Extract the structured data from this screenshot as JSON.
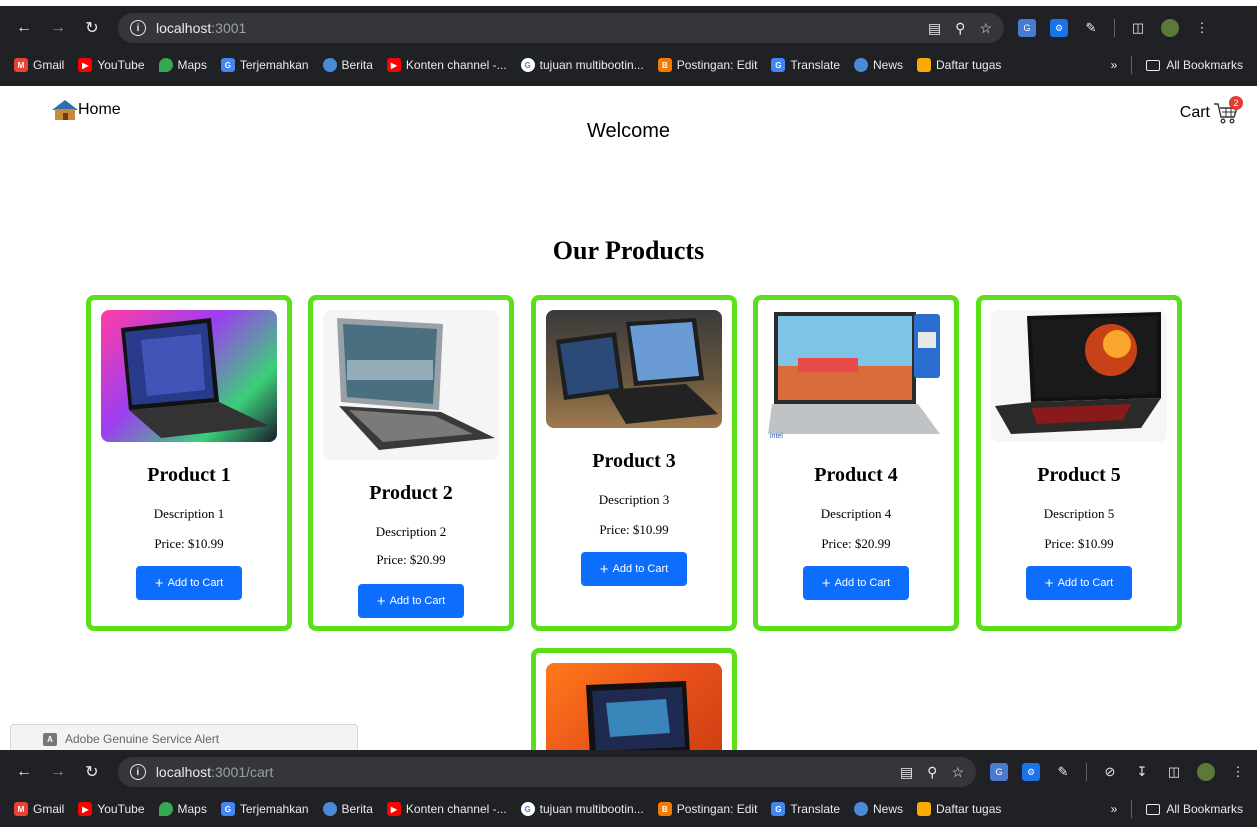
{
  "browser_top": {
    "url_host": "localhost",
    "url_rest": ":3001",
    "bookmarks": [
      {
        "label": "Gmail",
        "icon": "gmail-icon"
      },
      {
        "label": "YouTube",
        "icon": "youtube-icon"
      },
      {
        "label": "Maps",
        "icon": "maps-icon"
      },
      {
        "label": "Terjemahkan",
        "icon": "translate-icon"
      },
      {
        "label": "Berita",
        "icon": "news-icon"
      },
      {
        "label": "Konten channel -...",
        "icon": "youtube-icon"
      },
      {
        "label": "tujuan multibootin...",
        "icon": "google-icon"
      },
      {
        "label": "Postingan: Edit",
        "icon": "blogger-icon"
      },
      {
        "label": "Translate",
        "icon": "translate-icon"
      },
      {
        "label": "News",
        "icon": "news-icon"
      },
      {
        "label": "Daftar tugas",
        "icon": "classroom-icon"
      }
    ],
    "more_label": "»",
    "all_bookmarks": "All Bookmarks"
  },
  "browser_bottom": {
    "url_host": "localhost",
    "url_rest": ":3001/cart"
  },
  "header": {
    "home_label": "Home",
    "welcome": "Welcome",
    "cart_label": "Cart",
    "cart_count": "2"
  },
  "products_title": "Our Products",
  "products": [
    {
      "name": "Product 1",
      "description": "Description 1",
      "price": "Price: $10.99",
      "button": "Add to Cart"
    },
    {
      "name": "Product 2",
      "description": "Description 2",
      "price": "Price: $20.99",
      "button": "Add to Cart"
    },
    {
      "name": "Product 3",
      "description": "Description 3",
      "price": "Price: $10.99",
      "button": "Add to Cart"
    },
    {
      "name": "Product 4",
      "description": "Description 4",
      "price": "Price: $20.99",
      "button": "Add to Cart"
    },
    {
      "name": "Product 5",
      "description": "Description 5",
      "price": "Price: $10.99",
      "button": "Add to Cart"
    }
  ],
  "adobe_alert": "Adobe Genuine Service Alert",
  "colors": {
    "card_border": "#5ae01b",
    "button": "#0d6efd",
    "badge": "#e53935",
    "chrome_bg": "#202124"
  }
}
